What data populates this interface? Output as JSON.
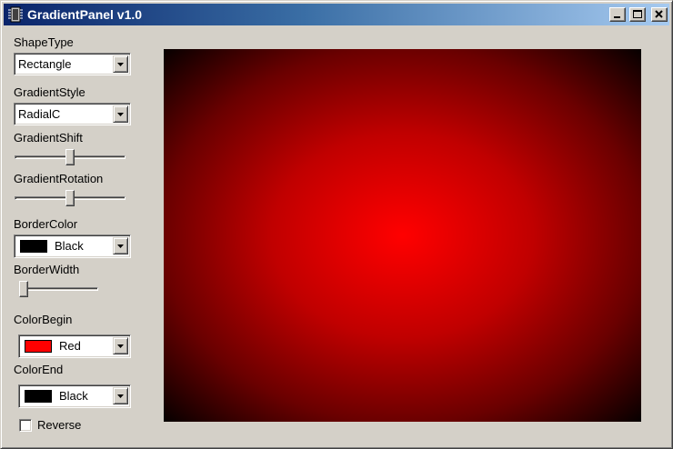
{
  "window": {
    "title": "GradientPanel v1.0",
    "app_icon": "chip-icon",
    "controls": [
      "minimize-icon",
      "maximize-icon",
      "close-icon"
    ]
  },
  "controls": {
    "shape_type": {
      "label": "ShapeType",
      "value": "Rectangle"
    },
    "gradient_style": {
      "label": "GradientStyle",
      "value": "RadialC"
    },
    "gradient_shift": {
      "label": "GradientShift",
      "level_fraction": 0.5
    },
    "gradient_rotation": {
      "label": "GradientRotation",
      "level_fraction": 0.5
    },
    "border_color": {
      "label": "BorderColor",
      "value": "Black",
      "swatch": "#000000"
    },
    "border_width": {
      "label": "BorderWidth",
      "level_fraction": 0.0
    },
    "color_begin": {
      "label": "ColorBegin",
      "value": "Red",
      "swatch": "#ff0000"
    },
    "color_end": {
      "label": "ColorEnd",
      "value": "Black",
      "swatch": "#000000"
    },
    "reverse": {
      "label": "Reverse",
      "checked": false
    }
  },
  "preview": {
    "center_color": "#ff0000",
    "edge_color": "#000000",
    "style": "radial"
  },
  "theme": {
    "face": "#d4d0c8",
    "title_gradient_start": "#0a246a",
    "title_gradient_end": "#a6caf0"
  }
}
